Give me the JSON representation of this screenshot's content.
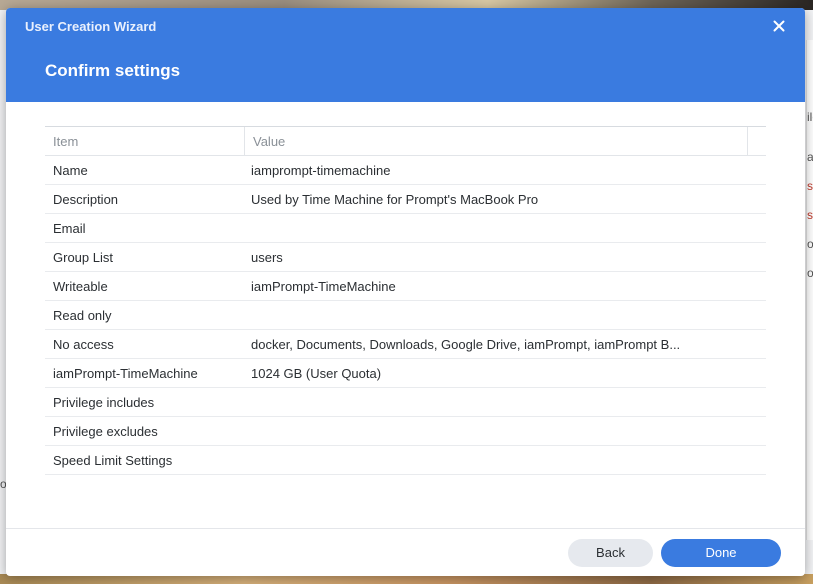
{
  "window": {
    "title": "User Creation Wizard",
    "close_icon": "close-icon"
  },
  "page": {
    "title": "Confirm settings"
  },
  "table": {
    "headers": [
      "Item",
      "Value"
    ],
    "rows": [
      {
        "item": "Name",
        "value": "iamprompt-timemachine"
      },
      {
        "item": "Description",
        "value": "Used by Time Machine for Prompt's MacBook Pro"
      },
      {
        "item": "Email",
        "value": ""
      },
      {
        "item": "Group List",
        "value": "users"
      },
      {
        "item": "Writeable",
        "value": "iamPrompt-TimeMachine"
      },
      {
        "item": "Read only",
        "value": ""
      },
      {
        "item": "No access",
        "value": "docker, Documents, Downloads, Google Drive, iamPrompt, iamPrompt B..."
      },
      {
        "item": "iamPrompt-TimeMachine",
        "value": "1024 GB (User Quota)"
      },
      {
        "item": "Privilege includes",
        "value": ""
      },
      {
        "item": "Privilege excludes",
        "value": ""
      },
      {
        "item": "Speed Limit Settings",
        "value": ""
      }
    ]
  },
  "footer": {
    "back_label": "Back",
    "done_label": "Done"
  },
  "background": {
    "right_fragments": [
      "ile",
      "a",
      "sa",
      "sa",
      "or",
      "or"
    ],
    "left_fragment": "o"
  },
  "colors": {
    "accent": "#3a7be0",
    "header_text": "#e9f0fd"
  }
}
